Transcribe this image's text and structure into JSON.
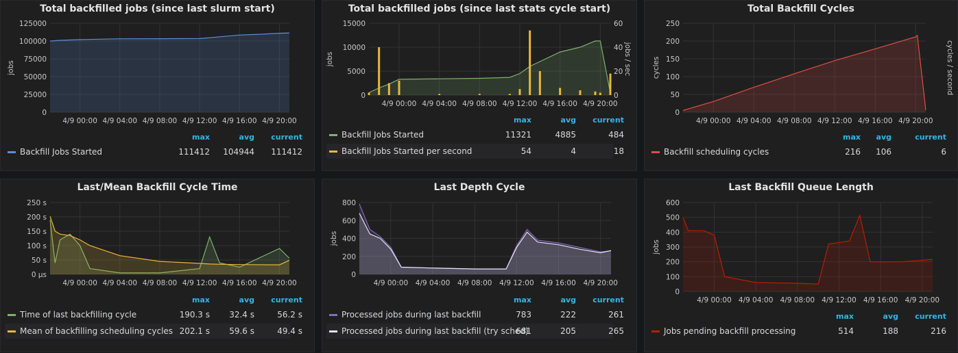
{
  "panels": [
    {
      "title": "Total backfilled jobs (since last slurm start)",
      "ylabel": "jobs",
      "ylabel_right": "",
      "yticks": [
        "125000",
        "100000",
        "75000",
        "50000",
        "25000",
        "0"
      ],
      "yticks_right": [],
      "xticks": [
        "4/9 00:00",
        "4/9 04:00",
        "4/9 08:00",
        "4/9 12:00",
        "4/9 16:00",
        "4/9 20:00"
      ],
      "legend_headers": [
        "max",
        "avg",
        "current"
      ],
      "legend": [
        {
          "name": "Backfill Jobs Started",
          "color": "#5b8fd6",
          "max": "111412",
          "avg": "104944",
          "current": "111412"
        }
      ]
    },
    {
      "title": "Total backfilled jobs (since last stats cycle start)",
      "ylabel": "jobs",
      "ylabel_right": "jobs / sec",
      "yticks": [
        "15000",
        "10000",
        "5000",
        "0"
      ],
      "yticks_right": [
        "60",
        "40",
        "20",
        "0"
      ],
      "xticks": [
        "4/9 00:00",
        "4/9 04:00",
        "4/9 08:00",
        "4/9 12:00",
        "4/9 16:00",
        "4/9 20:00"
      ],
      "legend_headers": [
        "max",
        "avg",
        "current"
      ],
      "legend": [
        {
          "name": "Backfill Jobs Started",
          "color": "#7eb26d",
          "max": "11321",
          "avg": "4885",
          "current": "484"
        },
        {
          "name": "Backfill Jobs Started per second",
          "color": "#eab839",
          "max": "54",
          "avg": "4",
          "current": "18"
        }
      ]
    },
    {
      "title": "Total Backfill Cycles",
      "ylabel": "cycles",
      "ylabel_right": "cycles / second",
      "yticks": [
        "250",
        "200",
        "150",
        "100",
        "50",
        "0"
      ],
      "yticks_right": [],
      "xticks": [
        "4/9 00:00",
        "4/9 04:00",
        "4/9 08:00",
        "4/9 12:00",
        "4/9 16:00",
        "4/9 20:00"
      ],
      "legend_headers": [
        "max",
        "avg",
        "current"
      ],
      "legend": [
        {
          "name": "Backfill scheduling cycles",
          "color": "#e24d42",
          "max": "216",
          "avg": "106",
          "current": "6"
        }
      ]
    },
    {
      "title": "Last/Mean Backfill Cycle Time",
      "ylabel": "",
      "ylabel_right": "",
      "yticks": [
        "250 s",
        "200 s",
        "150 s",
        "100 s",
        "50 s",
        "0 µs"
      ],
      "yticks_right": [],
      "xticks": [
        "4/9 00:00",
        "4/9 04:00",
        "4/9 08:00",
        "4/9 12:00",
        "4/9 16:00",
        "4/9 20:00"
      ],
      "legend_headers": [
        "max",
        "avg",
        "current"
      ],
      "legend": [
        {
          "name": "Time of last backfilling cycle",
          "color": "#7eb26d",
          "max": "190.3 s",
          "avg": "32.4 s",
          "current": "56.2 s"
        },
        {
          "name": "Mean of backfilling scheduling cycles",
          "color": "#eab839",
          "max": "202.1 s",
          "avg": "59.6 s",
          "current": "49.4 s"
        }
      ]
    },
    {
      "title": "Last Depth Cycle",
      "ylabel": "jobs",
      "ylabel_right": "",
      "yticks": [
        "800",
        "600",
        "400",
        "200",
        "0"
      ],
      "yticks_right": [],
      "xticks": [
        "4/9 00:00",
        "4/9 04:00",
        "4/9 08:00",
        "4/9 12:00",
        "4/9 16:00",
        "4/9 20:00"
      ],
      "legend_headers": [
        "max",
        "avg",
        "current"
      ],
      "legend": [
        {
          "name": "Processed jobs during last backfill",
          "color": "#806eb7",
          "max": "783",
          "avg": "222",
          "current": "261"
        },
        {
          "name": "Processed jobs during last backfill (try sched)",
          "color": "#e6e1f5",
          "max": "681",
          "avg": "205",
          "current": "265"
        }
      ]
    },
    {
      "title": "Last Backfill Queue Length",
      "ylabel": "jobs",
      "ylabel_right": "",
      "yticks": [
        "600",
        "500",
        "400",
        "300",
        "200",
        "100",
        "0"
      ],
      "yticks_right": [],
      "xticks": [
        "4/9 00:00",
        "4/9 04:00",
        "4/9 08:00",
        "4/9 12:00",
        "4/9 16:00",
        "4/9 20:00"
      ],
      "legend_headers": [
        "max",
        "avg",
        "current"
      ],
      "legend": [
        {
          "name": "Jobs pending backfill processing",
          "color": "#bf1b00",
          "max": "514",
          "avg": "188",
          "current": "216"
        }
      ]
    }
  ],
  "chart_data": [
    {
      "type": "area",
      "title": "Total backfilled jobs (since last slurm start)",
      "ylabel": "jobs",
      "ylim": [
        0,
        125000
      ],
      "x": [
        "4/8 21:00",
        "4/8 22:00",
        "4/9 00:00",
        "4/9 04:00",
        "4/9 08:00",
        "4/9 12:00",
        "4/9 14:00",
        "4/9 16:00",
        "4/9 18:00",
        "4/9 20:00",
        "4/9 21:00"
      ],
      "series": [
        {
          "name": "Backfill Jobs Started",
          "values": [
            100000,
            101000,
            102000,
            103200,
            103300,
            103500,
            106000,
            108500,
            109500,
            111000,
            111412
          ]
        }
      ]
    },
    {
      "type": "area",
      "title": "Total backfilled jobs (since last stats cycle start)",
      "ylabel": "jobs",
      "ylim": [
        0,
        15000
      ],
      "ylabel_right": "jobs / sec",
      "ylim_right": [
        0,
        60
      ],
      "x": [
        "4/8 21:00",
        "4/8 22:00",
        "4/8 23:00",
        "4/9 00:00",
        "4/9 04:00",
        "4/9 08:00",
        "4/9 11:00",
        "4/9 12:00",
        "4/9 13:00",
        "4/9 14:00",
        "4/9 16:00",
        "4/9 18:00",
        "4/9 19:30",
        "4/9 20:00",
        "4/9 21:00"
      ],
      "series": [
        {
          "name": "Backfill Jobs Started",
          "values": [
            500,
            1500,
            2300,
            3300,
            3400,
            3500,
            3700,
            4500,
            6000,
            7000,
            9000,
            10000,
            11300,
            11321,
            484
          ]
        },
        {
          "name": "Backfill Jobs Started per second",
          "values": [
            2,
            40,
            10,
            12,
            1,
            1,
            1,
            5,
            54,
            20,
            6,
            4,
            3,
            2,
            18
          ]
        }
      ]
    },
    {
      "type": "area",
      "title": "Total Backfill Cycles",
      "ylabel": "cycles",
      "ylim": [
        0,
        250
      ],
      "ylabel_right": "cycles / second",
      "x": [
        "4/8 21:00",
        "4/9 00:00",
        "4/9 04:00",
        "4/9 08:00",
        "4/9 12:00",
        "4/9 16:00",
        "4/9 20:00",
        "4/9 20:10",
        "4/9 21:00"
      ],
      "series": [
        {
          "name": "Backfill scheduling cycles",
          "values": [
            5,
            30,
            70,
            108,
            145,
            178,
            212,
            216,
            6
          ]
        }
      ]
    },
    {
      "type": "line",
      "title": "Last/Mean Backfill Cycle Time",
      "ylim": [
        0,
        250
      ],
      "x": [
        "4/8 21:00",
        "4/8 21:30",
        "4/8 22:00",
        "4/8 23:00",
        "4/9 00:00",
        "4/9 01:00",
        "4/9 04:00",
        "4/9 08:00",
        "4/9 12:00",
        "4/9 13:00",
        "4/9 14:00",
        "4/9 16:00",
        "4/9 20:00",
        "4/9 21:00"
      ],
      "series": [
        {
          "name": "Time of last backfilling cycle",
          "values": [
            190,
            40,
            120,
            140,
            100,
            20,
            5,
            5,
            20,
            130,
            40,
            25,
            90,
            56
          ]
        },
        {
          "name": "Mean of backfilling scheduling cycles",
          "values": [
            202,
            150,
            140,
            135,
            120,
            100,
            65,
            45,
            38,
            36,
            35,
            34,
            33,
            49
          ]
        }
      ]
    },
    {
      "type": "line",
      "title": "Last Depth Cycle",
      "ylabel": "jobs",
      "ylim": [
        0,
        800
      ],
      "x": [
        "4/8 21:00",
        "4/8 22:00",
        "4/8 23:00",
        "4/9 00:00",
        "4/9 01:00",
        "4/9 04:00",
        "4/9 08:00",
        "4/9 11:00",
        "4/9 12:00",
        "4/9 13:00",
        "4/9 14:00",
        "4/9 16:00",
        "4/9 18:00",
        "4/9 20:00",
        "4/9 21:00"
      ],
      "series": [
        {
          "name": "Processed jobs during last backfill",
          "values": [
            783,
            500,
            420,
            300,
            80,
            70,
            60,
            60,
            320,
            500,
            380,
            350,
            300,
            250,
            261
          ]
        },
        {
          "name": "Processed jobs during last backfill (try sched)",
          "values": [
            681,
            450,
            400,
            280,
            80,
            70,
            60,
            60,
            300,
            470,
            360,
            330,
            280,
            240,
            265
          ]
        }
      ]
    },
    {
      "type": "area",
      "title": "Last Backfill Queue Length",
      "ylabel": "jobs",
      "ylim": [
        0,
        600
      ],
      "x": [
        "4/8 21:00",
        "4/8 21:30",
        "4/8 23:00",
        "4/9 00:00",
        "4/9 01:00",
        "4/9 04:00",
        "4/9 08:00",
        "4/9 10:00",
        "4/9 11:00",
        "4/9 13:00",
        "4/9 14:00",
        "4/9 15:00",
        "4/9 18:00",
        "4/9 20:00",
        "4/9 21:00"
      ],
      "series": [
        {
          "name": "Jobs pending backfill processing",
          "values": [
            500,
            410,
            410,
            380,
            100,
            60,
            55,
            50,
            320,
            340,
            514,
            200,
            200,
            210,
            216
          ]
        }
      ]
    }
  ]
}
